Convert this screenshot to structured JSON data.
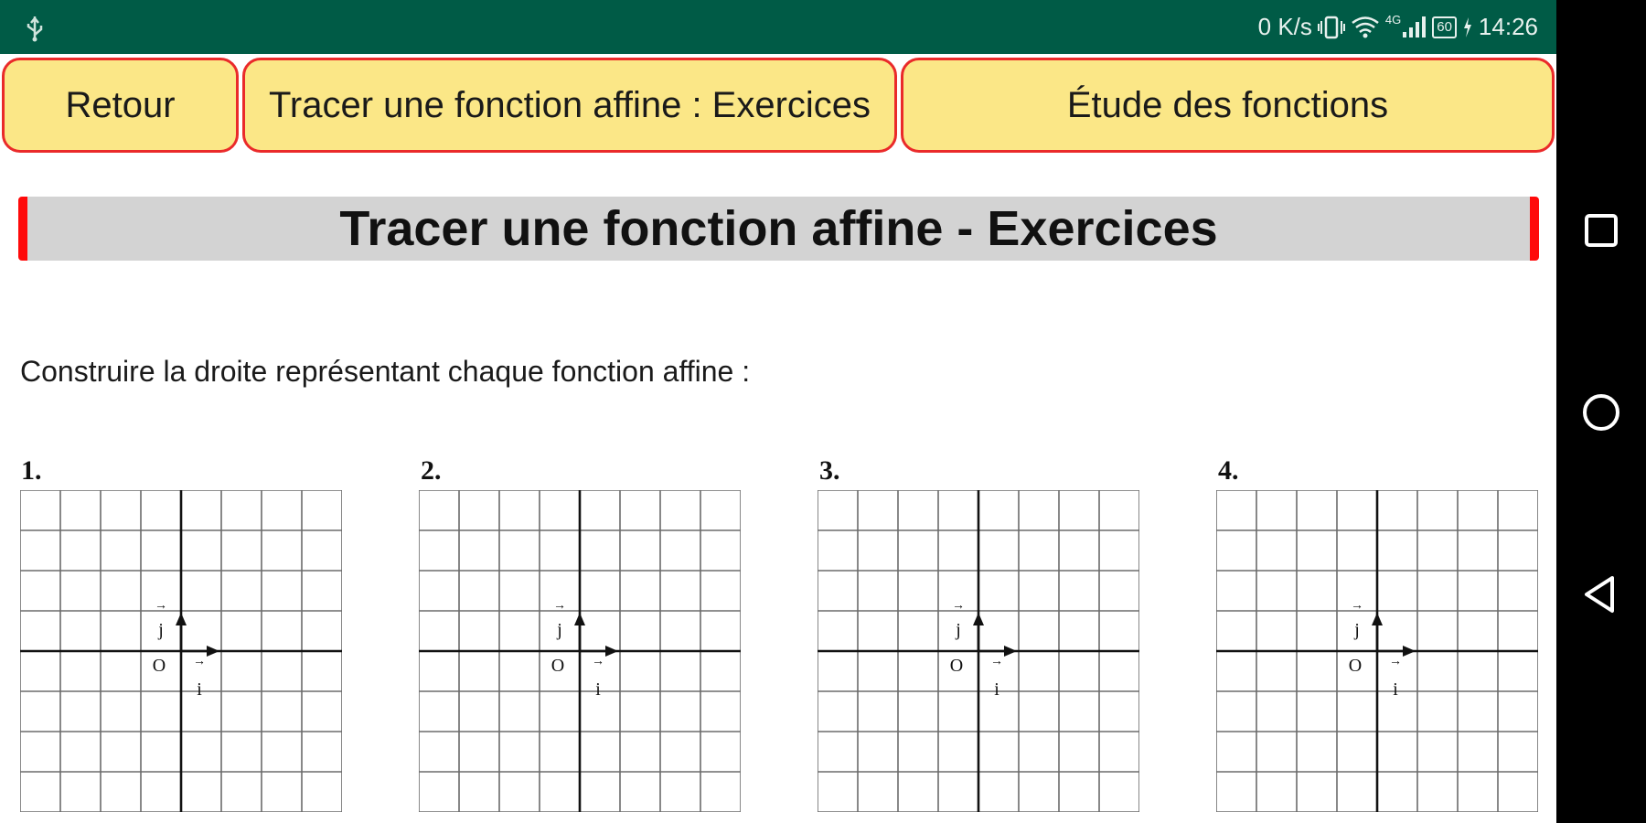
{
  "status_bar": {
    "speed": "0 K/s",
    "network": "4G",
    "battery": "60",
    "time": "14:26",
    "background": "#005b46"
  },
  "buttons": {
    "back": "Retour",
    "current": "Tracer une fonction affine : Exercices",
    "study": "Étude des fonctions"
  },
  "title": "Tracer une fonction affine - Exercices",
  "instruction": "Construire la droite représentant chaque fonction affine :",
  "exercises": [
    {
      "label": "1."
    },
    {
      "label": "2."
    },
    {
      "label": "3."
    },
    {
      "label": "4."
    }
  ],
  "grid_labels": {
    "origin": "O",
    "j": "j",
    "i": "i",
    "arrow": "→"
  },
  "colors": {
    "button_fill": "#fbe787",
    "button_border": "#ea2a2a",
    "title_fill": "#d3d3d3",
    "title_accent": "#ff0a0a"
  }
}
